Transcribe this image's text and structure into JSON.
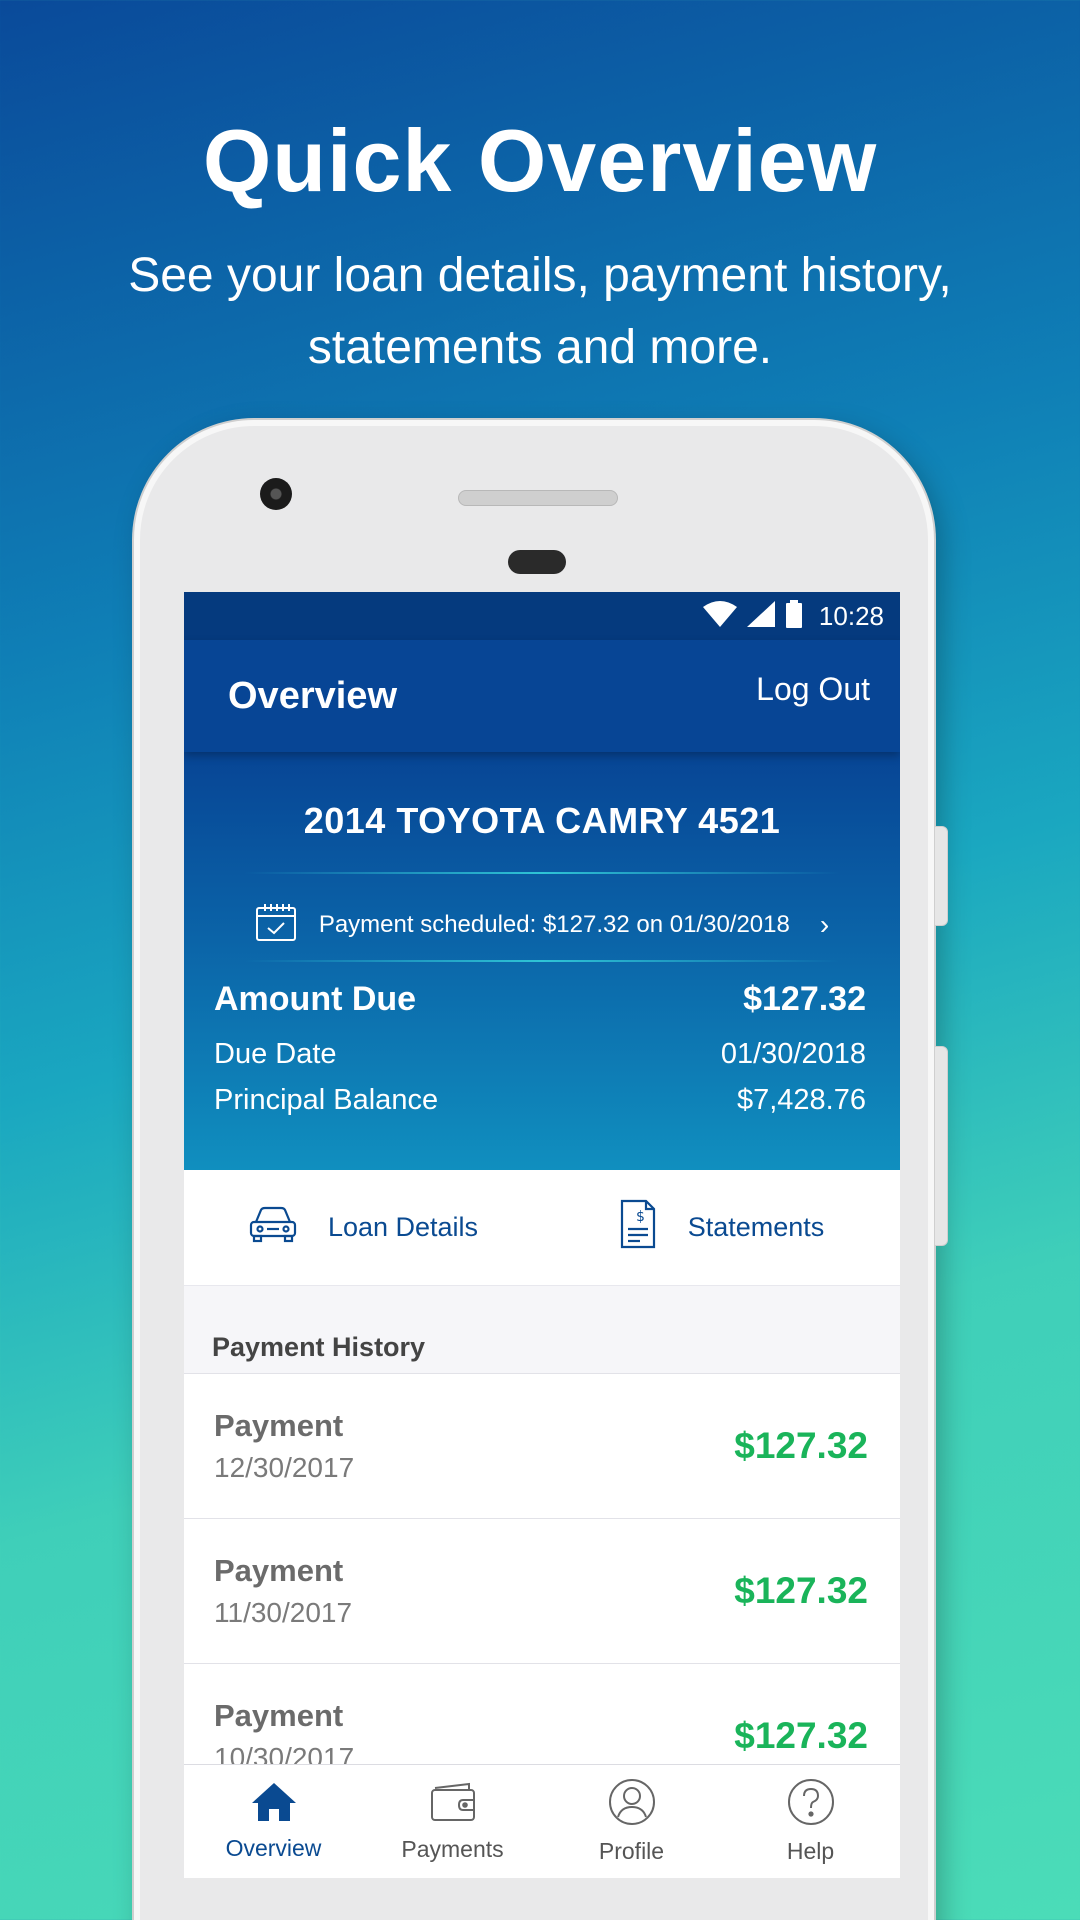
{
  "promo": {
    "title": "Quick Overview",
    "subtitle_line1": "See your loan details, payment history,",
    "subtitle_line2": "statements and more."
  },
  "status_bar": {
    "time": "10:28"
  },
  "appbar": {
    "title": "Overview",
    "logout_label": "Log Out"
  },
  "vehicle": "2014 TOYOTA CAMRY 4521",
  "scheduled": {
    "text": "Payment scheduled: $127.32 on 01/30/2018"
  },
  "summary": {
    "amount_due_label": "Amount Due",
    "amount_due_value": "$127.32",
    "due_date_label": "Due Date",
    "due_date_value": "01/30/2018",
    "principal_label": "Principal Balance",
    "principal_value": "$7,428.76"
  },
  "quick_links": {
    "loan_details": "Loan Details",
    "statements": "Statements"
  },
  "history": {
    "header": "Payment History",
    "rows": [
      {
        "label": "Payment",
        "date": "12/30/2017",
        "amount": "$127.32"
      },
      {
        "label": "Payment",
        "date": "11/30/2017",
        "amount": "$127.32"
      },
      {
        "label": "Payment",
        "date": "10/30/2017",
        "amount": "$127.32"
      }
    ]
  },
  "nav": {
    "items": [
      {
        "label": "Overview",
        "icon": "home-icon"
      },
      {
        "label": "Payments",
        "icon": "wallet-icon"
      },
      {
        "label": "Profile",
        "icon": "profile-icon"
      },
      {
        "label": "Help",
        "icon": "help-icon"
      }
    ],
    "active": "Overview"
  },
  "colors": {
    "brand": "#074595",
    "amount_green": "#1ab45a",
    "link_blue": "#0a4a91"
  }
}
